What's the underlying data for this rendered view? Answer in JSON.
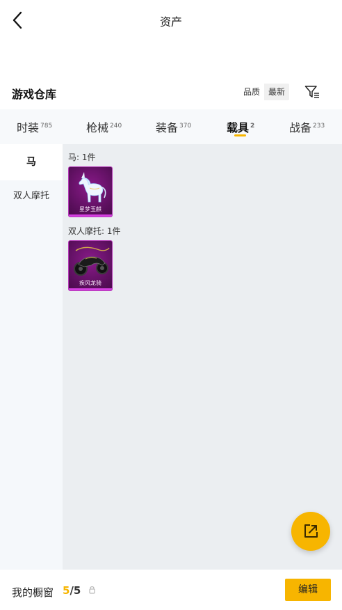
{
  "header": {
    "title": "资产"
  },
  "warehouse": {
    "title": "游戏仓库",
    "sort_options": [
      "品质",
      "最新"
    ]
  },
  "tabs": [
    {
      "label": "时装",
      "count": "785",
      "active": false
    },
    {
      "label": "枪械",
      "count": "240",
      "active": false
    },
    {
      "label": "装备",
      "count": "370",
      "active": false
    },
    {
      "label": "载具",
      "count": "2",
      "active": true
    },
    {
      "label": "战备",
      "count": "233",
      "active": false
    }
  ],
  "sidebar": {
    "items": [
      {
        "label": "马",
        "active": true
      },
      {
        "label": "双人摩托",
        "active": false
      }
    ]
  },
  "groups": [
    {
      "label": "马: 1件",
      "items": [
        {
          "name": "星梦玉麒",
          "icon": "unicorn-icon"
        }
      ]
    },
    {
      "label": "双人摩托: 1件",
      "items": [
        {
          "name": "疾风龙骑",
          "icon": "motorcycle-icon"
        }
      ]
    }
  ],
  "bottom": {
    "label": "我的橱窗",
    "used": "5",
    "sep": "/",
    "total": "5",
    "edit_label": "编辑"
  },
  "colors": {
    "accent": "#f7b500",
    "rarity_purple": "#b53ab8",
    "sidebar_bg": "#f5f8fb",
    "content_bg": "#ebeef1"
  }
}
